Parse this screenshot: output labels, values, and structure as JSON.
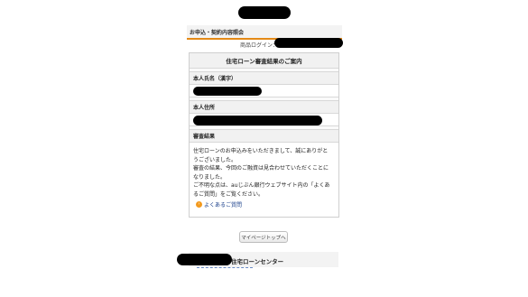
{
  "header": {
    "breadcrumb": "お申込・契約内容照会",
    "login_label": "商品ログイン："
  },
  "panel": {
    "title": "住宅ローン審査結果のご案内",
    "name_label": "本人氏名（漢字）",
    "address_label": "本人住所",
    "result_label": "審査結果",
    "result_lines": [
      "住宅ローンのお申込みをいただきまして、誠にありがと",
      "うございました。",
      "審査の結果、今回のご融資は見合わせていただくことに",
      "なりました。",
      "ご不明な点は、auじぶん銀行ウェブサイト内の「よくあ",
      "るご質問」をご覧ください。"
    ],
    "faq_link": "よくあるご質問",
    "faq_icon": "›"
  },
  "buttons": {
    "mypage": "マイページトップへ"
  },
  "footer": {
    "title": "住宅ローンセンター"
  },
  "colors": {
    "accent": "#e48a17",
    "link": "#1a3f8a"
  }
}
